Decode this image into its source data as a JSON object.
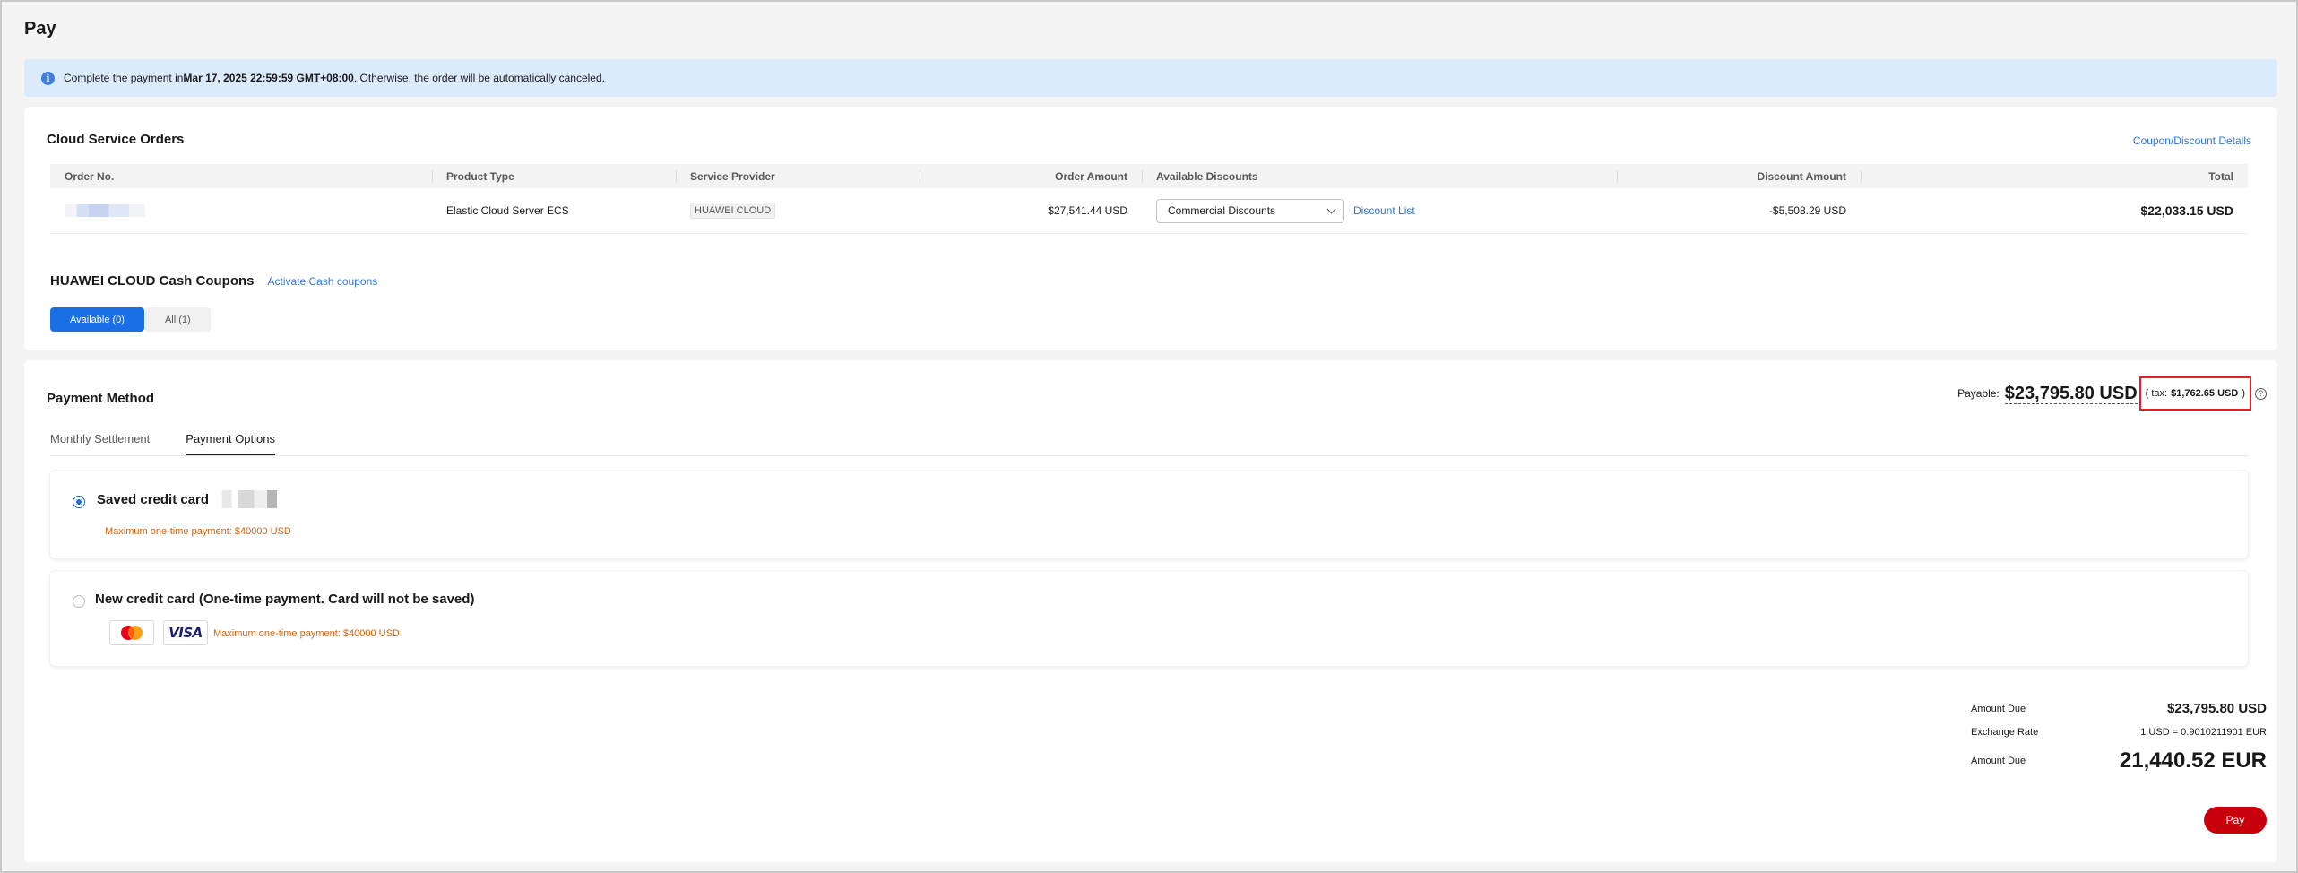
{
  "page": {
    "title": "Pay"
  },
  "notice": {
    "prefix": "Complete the payment in ",
    "deadline": "Mar 17, 2025 22:59:59 GMT+08:00",
    "suffix": ". Otherwise, the order will be automatically canceled."
  },
  "orders": {
    "title": "Cloud Service Orders",
    "details_link": "Coupon/Discount Details",
    "columns": [
      "Order No.",
      "Product Type",
      "Service Provider",
      "Order Amount",
      "Available Discounts",
      "Discount Amount",
      "Total"
    ],
    "row": {
      "product_type": "Elastic Cloud Server ECS",
      "provider": "HUAWEI CLOUD",
      "order_amount": "$27,541.44 USD",
      "discount_selected": "Commercial Discounts",
      "discount_list_link": "Discount List",
      "discount_amount": "-$5,508.29 USD",
      "total": "$22,033.15 USD"
    }
  },
  "coupons": {
    "title": "HUAWEI CLOUD Cash Coupons",
    "activate_link": "Activate Cash coupons",
    "tabs": [
      "Available (0)",
      "All (1)"
    ]
  },
  "payment": {
    "title": "Payment Method",
    "payable_label": "Payable:",
    "payable_amount": "$23,795.80 USD",
    "tax_open": "( tax:",
    "tax_amount": "$1,762.65 USD",
    "tax_close": ")",
    "tabs": [
      "Monthly Settlement",
      "Payment Options"
    ],
    "saved_card_label": "Saved credit card",
    "saved_card_note": "Maximum one-time payment: $40000 USD",
    "new_card_label": "New credit card (One-time payment. Card will not be saved)",
    "new_card_note": "Maximum one-time payment: $40000 USD",
    "visa_label": "VISA"
  },
  "summary": {
    "amount_due_label": "Amount Due",
    "amount_due_usd": "$23,795.80 USD",
    "exchange_label": "Exchange Rate",
    "exchange_value": "1 USD = 0.9010211901 EUR",
    "amount_due_label2": "Amount Due",
    "amount_due_eur": "21,440.52 EUR",
    "pay_button": "Pay"
  },
  "colors": {
    "primary_blue": "#1a6ee6",
    "pay_red": "#c7000b",
    "warning_orange": "#d4620a",
    "highlight_red": "#e31e24"
  }
}
